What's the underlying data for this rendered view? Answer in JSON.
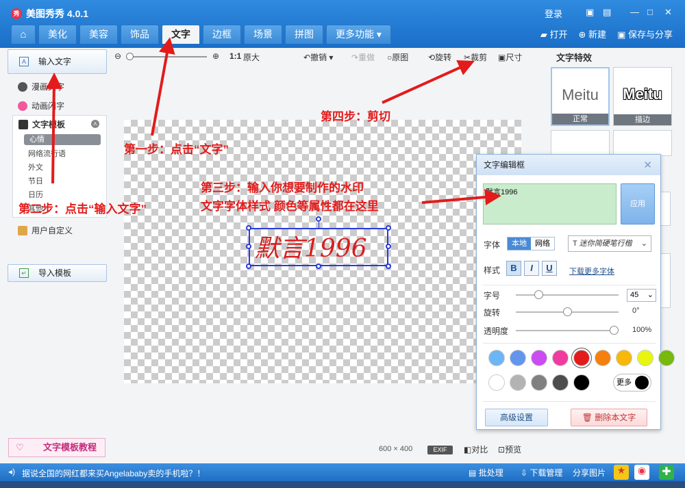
{
  "app": {
    "title": "美图秀秀 4.0.1",
    "logo_text": "秀",
    "login": "登录"
  },
  "tabs": [
    "美化",
    "美容",
    "饰品",
    "文字",
    "边框",
    "场景",
    "拼图",
    "更多功能"
  ],
  "top_actions": {
    "open": "打开",
    "new": "新建",
    "save_share": "保存与分享"
  },
  "sidebar": {
    "input_text": "输入文字",
    "comic_text": "漫画文字",
    "anim_text": "动画闪字",
    "template": "文字模板",
    "template_items": [
      "心情",
      "网络流行语",
      "外文",
      "节日",
      "日历",
      "其他"
    ],
    "user_defined": "用户自定义",
    "import_template": "导入模板",
    "template_tutorial": "文字模板教程"
  },
  "toolbar": {
    "zoom_label": "1:1",
    "original_size": "原大",
    "undo": "撤销",
    "redo": "重做",
    "original_image": "原图",
    "rotate": "旋转",
    "crop": "裁剪",
    "size": "尺寸"
  },
  "canvas": {
    "watermark_text": "默言1996",
    "dimensions_w": "600",
    "dimensions_x": "×",
    "dimensions_h": "400",
    "exif": "EXIF",
    "compare": "对比",
    "preview": "预览"
  },
  "effects": {
    "title": "文字特效",
    "items": [
      {
        "sample": "Meitu",
        "name": "正常"
      },
      {
        "sample": "Meitu",
        "name": "描边"
      }
    ]
  },
  "dialog": {
    "title": "文字编辑框",
    "text_value": "默言1996",
    "apply": "应用",
    "font_label": "字体",
    "font_local": "本地",
    "font_web": "网络",
    "font_name": "迷你简硬笔行楷",
    "style_label": "样式",
    "style_b": "B",
    "style_i": "I",
    "style_u": "U",
    "download_fonts": "下载更多字体",
    "size_label": "字号",
    "size_value": "45",
    "size_fraction": 0.2,
    "rotate_label": "旋转",
    "rotate_value": "0°",
    "rotate_fraction": 0.5,
    "opacity_label": "透明度",
    "opacity_value": "100%",
    "opacity_fraction": 1.0,
    "colors": [
      "#6db6f5",
      "#6495ed",
      "#c94df0",
      "#f03ca0",
      "#e31b1b",
      "#f5800f",
      "#f7b80a",
      "#e7f50f",
      "#76b90f",
      "#ffffff",
      "#b3b3b3",
      "#808080",
      "#4d4d4d",
      "#000000"
    ],
    "selected_color": "#e31b1b",
    "more_colors": "更多",
    "advanced": "高级设置",
    "delete_text": "删除本文字"
  },
  "status": {
    "news": "据说全国的网红都来买Angelababy卖的手机啦？！",
    "batch": "批处理",
    "download_mgr": "下载管理",
    "share": "分享图片"
  },
  "annotations": {
    "step1": "第一步：点击“文字”",
    "step2": "第二步：点击“输入文字”",
    "step3_line1": "第三步：输入你想要制作的水印",
    "step3_line2": "文字字体样式 颜色等属性都在这里",
    "step4": "第四步：剪切"
  }
}
